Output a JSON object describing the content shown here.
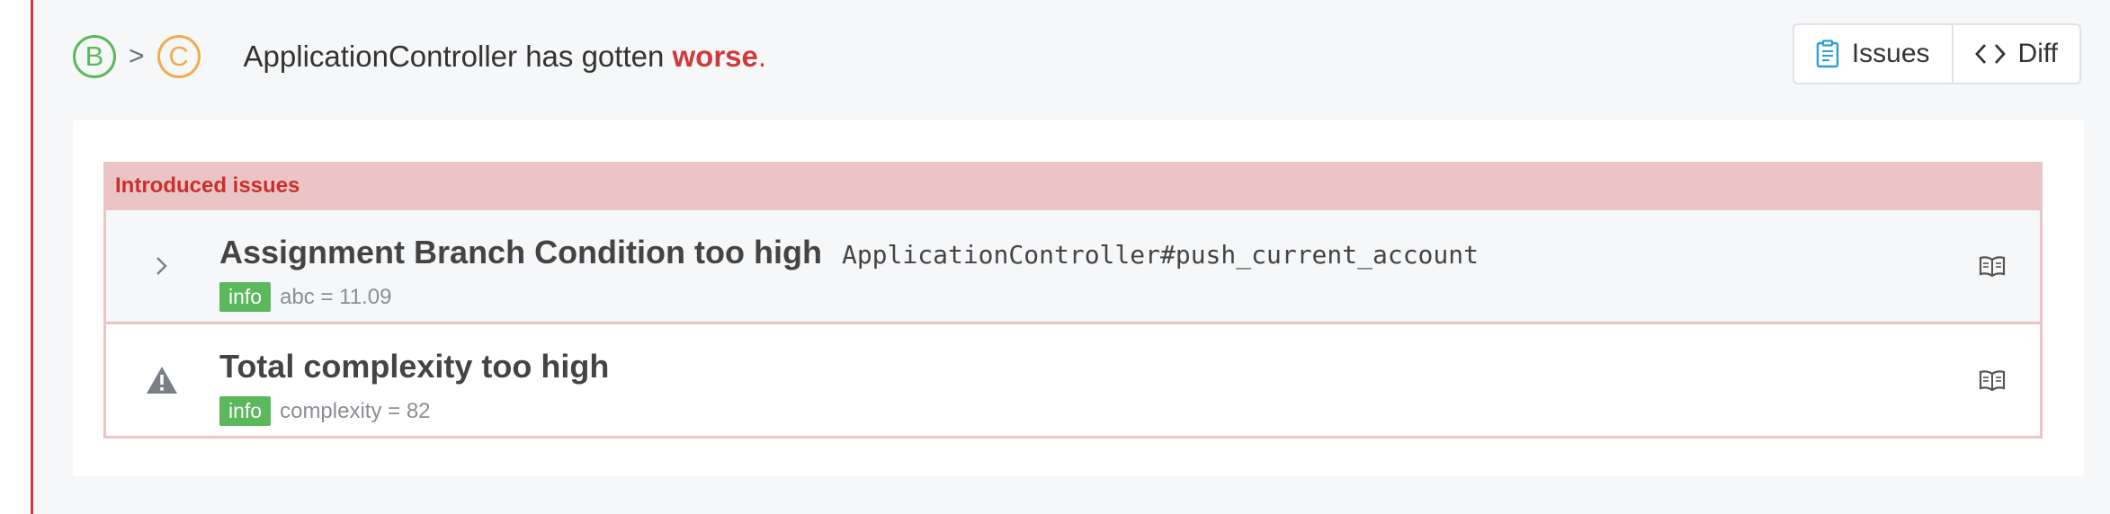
{
  "header": {
    "grade_from": "B",
    "grade_separator": ">",
    "grade_to": "C",
    "subject": "ApplicationController",
    "verb": " has gotten ",
    "status": "worse",
    "period": "."
  },
  "buttons": {
    "issues_label": "Issues",
    "diff_label": "Diff"
  },
  "introduced": {
    "heading": "Introduced issues",
    "items": [
      {
        "title": "Assignment Branch Condition too high",
        "location": "ApplicationController#push_current_account",
        "badge": "info",
        "metric": "abc = 11.09",
        "lead_icon": "chevron-right-icon"
      },
      {
        "title": "Total complexity too high",
        "location": "",
        "badge": "info",
        "metric": "complexity = 82",
        "lead_icon": "warning-icon"
      }
    ]
  },
  "colors": {
    "accent_red": "#d0393a",
    "grade_b": "#5cb85c",
    "grade_c": "#f0ad4e",
    "badge_green": "#5cb85c",
    "issue_border": "#ebc5c5"
  }
}
